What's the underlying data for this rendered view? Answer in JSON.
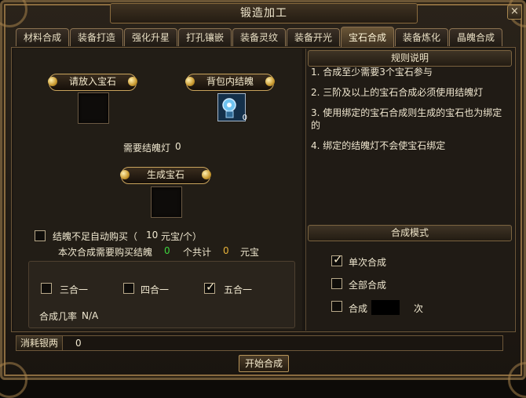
{
  "window": {
    "title": "锻造加工",
    "close_label": "×"
  },
  "tabs": [
    "材料合成",
    "装备打造",
    "强化升星",
    "打孔镶嵌",
    "装备灵纹",
    "装备开光",
    "宝石合成",
    "装备炼化",
    "晶魄合成"
  ],
  "active_tab": "宝石合成",
  "left": {
    "put_gem_button": "请放入宝石",
    "bag_soul_button": "背包内结魄",
    "bag_soul_count": "0",
    "need_lamp_label": "需要结魄灯",
    "need_lamp_value": "0",
    "generate_button": "生成宝石",
    "auto_buy_label": "结魄不足自动购买（",
    "auto_buy_price": "10",
    "auto_buy_unit": "元宝/个）",
    "auto_buy_checked": false,
    "buy_need_label": "本次合成需要购买结魄",
    "buy_need_count": "0",
    "buy_total_label": "个共计",
    "buy_total_value": "0",
    "buy_currency": "元宝",
    "combine_options": [
      {
        "label": "三合一",
        "checked": false
      },
      {
        "label": "四合一",
        "checked": false
      },
      {
        "label": "五合一",
        "checked": true
      }
    ],
    "success_rate_label": "合成几率",
    "success_rate_value": "N/A"
  },
  "right": {
    "rules_header": "规则说明",
    "rules": [
      "1. 合成至少需要3个宝石参与",
      "2. 三阶及以上的宝石合成必须使用结魄灯",
      "3. 使用绑定的宝石合成则生成的宝石也为绑定的",
      "4. 绑定的结魄灯不会使宝石绑定"
    ],
    "mode_header": "合成模式",
    "modes": [
      {
        "label": "单次合成",
        "checked": true
      },
      {
        "label": "全部合成",
        "checked": false
      }
    ],
    "custom_mode_label": "合成",
    "custom_mode_checked": false,
    "custom_mode_suffix": "次"
  },
  "footer": {
    "cost_label": "消耗银两",
    "cost_value": "0",
    "start_button": "开始合成"
  },
  "colors": {
    "accent_gold": "#c9a35c",
    "green_text": "#3ed43e",
    "gold_text": "#e7b23a"
  },
  "icons": {
    "gem_item": "blue-gem-lantern-icon",
    "close": "close-icon"
  }
}
